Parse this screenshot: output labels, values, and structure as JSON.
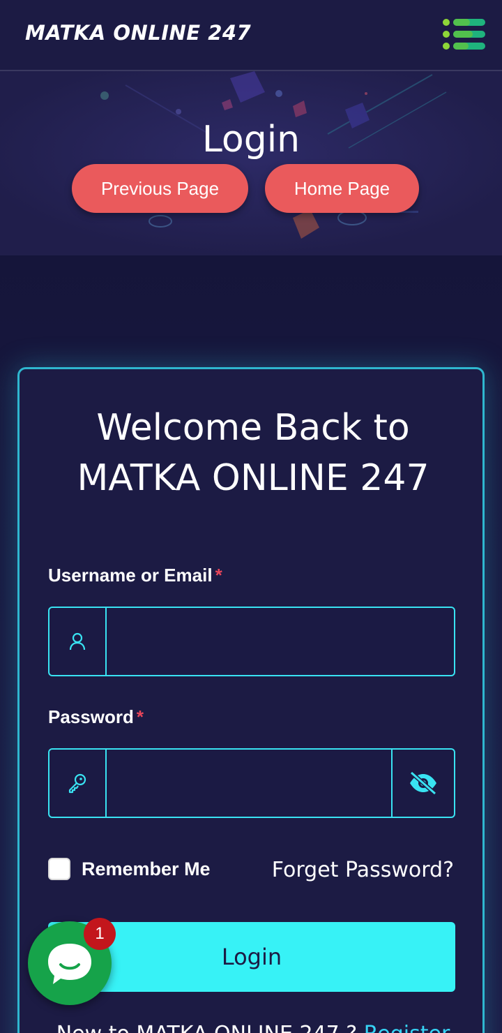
{
  "header": {
    "brand": "MATKA ONLINE 247",
    "menu_icon": "menu-lines-icon"
  },
  "hero": {
    "title": "Login",
    "previous_label": "Previous Page",
    "home_label": "Home Page"
  },
  "login_card": {
    "welcome_line1": "Welcome Back to",
    "welcome_line2": "MATKA ONLINE 247",
    "username_label": "Username or Email",
    "password_label": "Password",
    "required_mark": "*",
    "username_value": "",
    "password_value": "",
    "username_icon": "user-icon",
    "password_icon": "key-icon",
    "toggle_icon": "eye-off-icon",
    "remember_label": "Remember Me",
    "remember_checked": false,
    "forget_label": "Forget Password?",
    "login_label": "Login",
    "register_prompt": "New to MATKA ONLINE 247 ?",
    "register_label": "Register"
  },
  "chat_widget": {
    "icon": "chat-bubble-icon",
    "badge_count": "1"
  },
  "colors": {
    "background": "#1c1b44",
    "accent": "#37f2f6",
    "pill": "#ea5a5c",
    "required": "#e8455a",
    "chat": "#16a34a",
    "badge": "#c3161c"
  }
}
